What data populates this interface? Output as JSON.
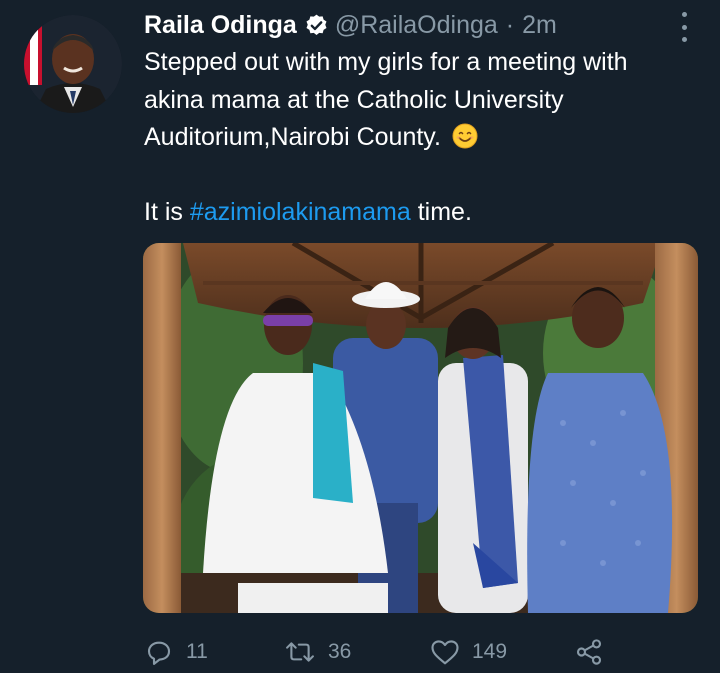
{
  "tweet": {
    "author_name": "Raila Odinga",
    "handle": "@RailaOdinga",
    "separator": "·",
    "time": "2m",
    "text_line1": "Stepped out with my girls for a meeting with",
    "text_line2": "akina mama at the Catholic University",
    "text_line3": "Auditorium,Nairobi County.",
    "text_line4_prefix": "It is ",
    "hashtag": "#azimiolakinamama",
    "text_line4_suffix": " time.",
    "emoji": "smiling-face-icon"
  },
  "actions": {
    "reply_count": "11",
    "retweet_count": "36",
    "like_count": "149"
  },
  "colors": {
    "background": "#15202b",
    "secondary_text": "#8899a6",
    "link": "#1d9bf0",
    "verified_badge": "#ffffff"
  }
}
